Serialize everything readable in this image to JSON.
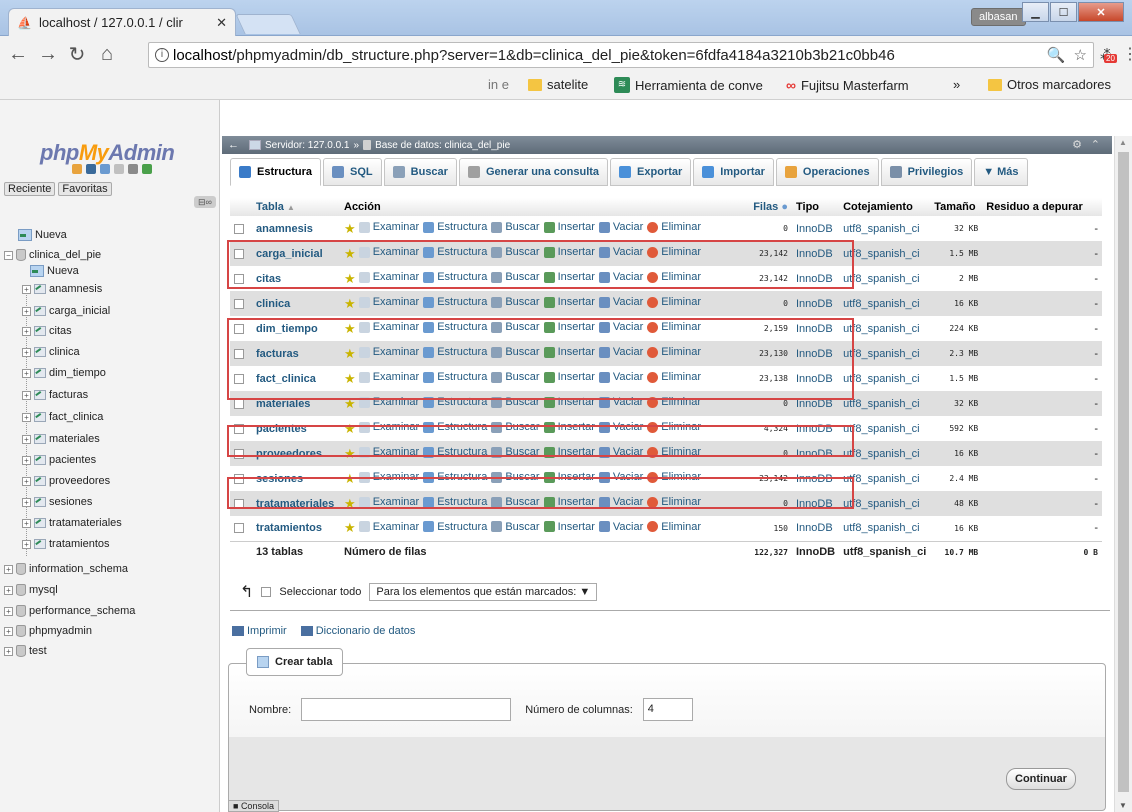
{
  "browser": {
    "tab_title": "localhost / 127.0.0.1 / clir",
    "user_badge": "albasan",
    "url_host": "localhost",
    "url_rest": "/phpmyadmin/db_structure.php?server=1&db=clinica_del_pie&token=6fdfa4184a3210b3b21c0bb46",
    "ext_badge": "20",
    "bookmarks": [
      {
        "label": "in e",
        "icon": "none"
      },
      {
        "label": "satelite",
        "icon": "folder-icon"
      },
      {
        "label": "Herramienta de conve",
        "icon": "green-icon"
      },
      {
        "label": "Fujitsu Masterfarm",
        "icon": "fujitsu-icon"
      },
      {
        "label": "»",
        "icon": "none"
      },
      {
        "label": "Otros marcadores",
        "icon": "folder-icon"
      }
    ]
  },
  "nav": {
    "brand_php": "php",
    "brand_my": "My",
    "brand_admin": "Admin",
    "tab_recent": "Reciente",
    "tab_favs": "Favoritas",
    "new_label": "Nueva",
    "db_current": "clinica_del_pie",
    "db_new": "Nueva",
    "tables": [
      "anamnesis",
      "carga_inicial",
      "citas",
      "clinica",
      "dim_tiempo",
      "facturas",
      "fact_clinica",
      "materiales",
      "pacientes",
      "proveedores",
      "sesiones",
      "tratamateriales",
      "tratamientos"
    ],
    "other_dbs": [
      "information_schema",
      "mysql",
      "performance_schema",
      "phpmyadmin",
      "test"
    ]
  },
  "breadcrumb": {
    "server": "Servidor: 127.0.0.1",
    "sep": "»",
    "db": "Base de datos: clinica_del_pie"
  },
  "tabs": [
    {
      "label": "Estructura",
      "color": "#3a7bc8"
    },
    {
      "label": "SQL",
      "color": "#6a8fc0"
    },
    {
      "label": "Buscar",
      "color": "#8aa0b8"
    },
    {
      "label": "Generar una consulta",
      "color": "#a0a0a0"
    },
    {
      "label": "Exportar",
      "color": "#4a90d9"
    },
    {
      "label": "Importar",
      "color": "#4a90d9"
    },
    {
      "label": "Operaciones",
      "color": "#e8a33d"
    },
    {
      "label": "Privilegios",
      "color": "#7a8fa8"
    },
    {
      "label": "▼ Más",
      "color": "none"
    }
  ],
  "table": {
    "headers": {
      "tabla": "Tabla",
      "sort": "▲",
      "accion": "Acción",
      "filas": "Filas",
      "tipo": "Tipo",
      "cotejamiento": "Cotejamiento",
      "tamano": "Tamaño",
      "residuo": "Residuo a depurar"
    },
    "actions": [
      "Examinar",
      "Estructura",
      "Buscar",
      "Insertar",
      "Vaciar",
      "Eliminar"
    ],
    "rows": [
      {
        "name": "anamnesis",
        "rows": "0",
        "type": "InnoDB",
        "collation": "utf8_spanish_ci",
        "size": "32 KB",
        "overhead": "-"
      },
      {
        "name": "carga_inicial",
        "rows": "23,142",
        "type": "InnoDB",
        "collation": "utf8_spanish_ci",
        "size": "1.5 MB",
        "overhead": "-"
      },
      {
        "name": "citas",
        "rows": "23,142",
        "type": "InnoDB",
        "collation": "utf8_spanish_ci",
        "size": "2 MB",
        "overhead": "-"
      },
      {
        "name": "clinica",
        "rows": "0",
        "type": "InnoDB",
        "collation": "utf8_spanish_ci",
        "size": "16 KB",
        "overhead": "-"
      },
      {
        "name": "dim_tiempo",
        "rows": "2,159",
        "type": "InnoDB",
        "collation": "utf8_spanish_ci",
        "size": "224 KB",
        "overhead": "-"
      },
      {
        "name": "facturas",
        "rows": "23,130",
        "type": "InnoDB",
        "collation": "utf8_spanish_ci",
        "size": "2.3 MB",
        "overhead": "-"
      },
      {
        "name": "fact_clinica",
        "rows": "23,138",
        "type": "InnoDB",
        "collation": "utf8_spanish_ci",
        "size": "1.5 MB",
        "overhead": "-"
      },
      {
        "name": "materiales",
        "rows": "0",
        "type": "InnoDB",
        "collation": "utf8_spanish_ci",
        "size": "32 KB",
        "overhead": "-"
      },
      {
        "name": "pacientes",
        "rows": "4,324",
        "type": "InnoDB",
        "collation": "utf8_spanish_ci",
        "size": "592 KB",
        "overhead": "-"
      },
      {
        "name": "proveedores",
        "rows": "0",
        "type": "InnoDB",
        "collation": "utf8_spanish_ci",
        "size": "16 KB",
        "overhead": "-"
      },
      {
        "name": "sesiones",
        "rows": "23,142",
        "type": "InnoDB",
        "collation": "utf8_spanish_ci",
        "size": "2.4 MB",
        "overhead": "-"
      },
      {
        "name": "tratamateriales",
        "rows": "0",
        "type": "InnoDB",
        "collation": "utf8_spanish_ci",
        "size": "48 KB",
        "overhead": "-"
      },
      {
        "name": "tratamientos",
        "rows": "150",
        "type": "InnoDB",
        "collation": "utf8_spanish_ci",
        "size": "16 KB",
        "overhead": "-"
      }
    ],
    "footer": {
      "count": "13 tablas",
      "label": "Número de filas",
      "rows": "122,327",
      "type": "InnoDB",
      "collation": "utf8_spanish_ci",
      "size": "10.7 MB",
      "overhead": "0 B"
    }
  },
  "bulk": {
    "select_all": "Seleccionar todo",
    "with_selected": "Para los elementos que están marcados:",
    "dropdown_arrow": "▼"
  },
  "links": {
    "print": "Imprimir",
    "dictionary": "Diccionario de datos"
  },
  "create": {
    "legend": "Crear tabla",
    "name_label": "Nombre:",
    "name_value": "",
    "cols_label": "Número de columnas:",
    "cols_value": "4",
    "submit": "Continuar"
  },
  "console": "Consola"
}
